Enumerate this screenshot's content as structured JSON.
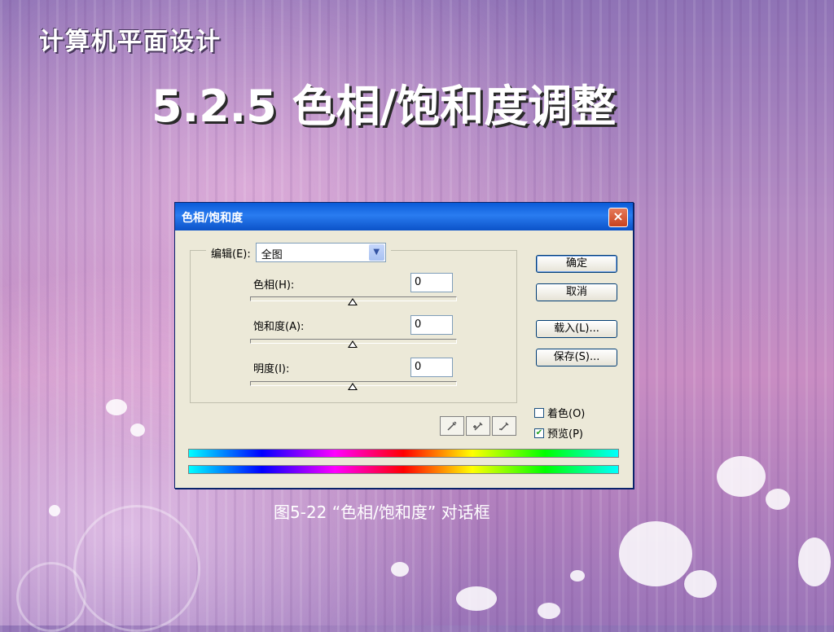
{
  "brand": "计算机平面设计",
  "slide_title": "5.2.5 色相/饱和度调整",
  "dialog": {
    "title": "色相/饱和度",
    "close_label": "×",
    "edit_label": "编辑(E):",
    "edit_value": "全图",
    "hue_label": "色相(H):",
    "hue_value": "0",
    "saturation_label": "饱和度(A):",
    "saturation_value": "0",
    "lightness_label": "明度(I):",
    "lightness_value": "0",
    "buttons": {
      "ok": "确定",
      "cancel": "取消",
      "load": "载入(L)...",
      "save": "保存(S)..."
    },
    "colorize_label": "着色(O)",
    "preview_label": "预览(P)",
    "preview_checked": "✔"
  },
  "caption": "图5-22 “色相/饱和度” 对话框"
}
